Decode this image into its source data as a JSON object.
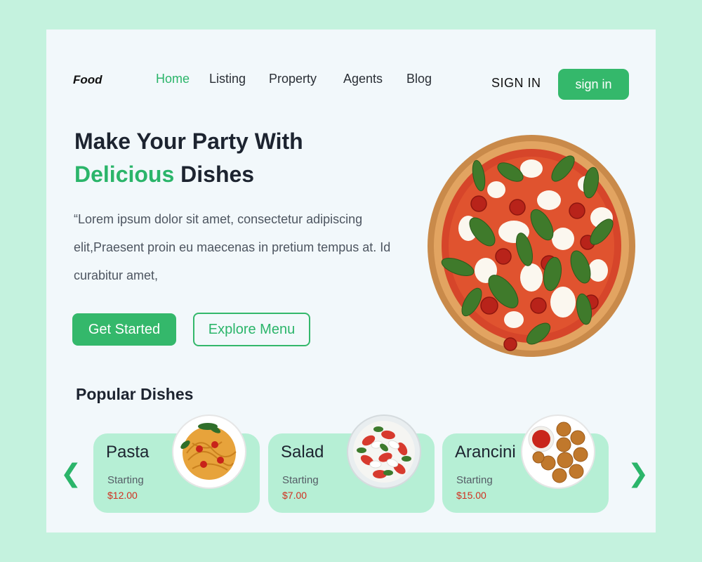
{
  "brand": {
    "logo": "Food"
  },
  "nav": {
    "items": [
      {
        "label": "Home",
        "active": true
      },
      {
        "label": "Listing"
      },
      {
        "label": "Property"
      },
      {
        "label": "Agents"
      },
      {
        "label": "Blog"
      }
    ],
    "signin_text": "SIGN IN",
    "signin_button": "sign in"
  },
  "hero": {
    "headline_line1": "Make Your Party With",
    "headline_accent": "Delicious",
    "headline_rest": " Dishes",
    "lead": "“Lorem ipsum dolor sit amet, consectetur adipiscing elit,Praesent proin eu maecenas in pretium tempus at. Id curabitur amet,",
    "primary_button": "Get Started",
    "secondary_button": "Explore Menu",
    "image_icon": "pizza-image"
  },
  "popular": {
    "title": "Popular Dishes",
    "prev_icon": "chevron-left-icon",
    "next_icon": "chevron-right-icon",
    "dishes": [
      {
        "name": "Pasta",
        "starting": "Starting",
        "price": "$12.00",
        "image": "pasta-image"
      },
      {
        "name": "Salad",
        "starting": "Starting",
        "price": "$7.00",
        "image": "salad-image"
      },
      {
        "name": "Arancini",
        "starting": "Starting",
        "price": "$15.00",
        "image": "arancini-image"
      }
    ]
  },
  "colors": {
    "accent": "#34b86b",
    "background": "#c4f2de",
    "card": "#f2f8fb",
    "dish_card": "#b6efd5",
    "price": "#d03020"
  }
}
